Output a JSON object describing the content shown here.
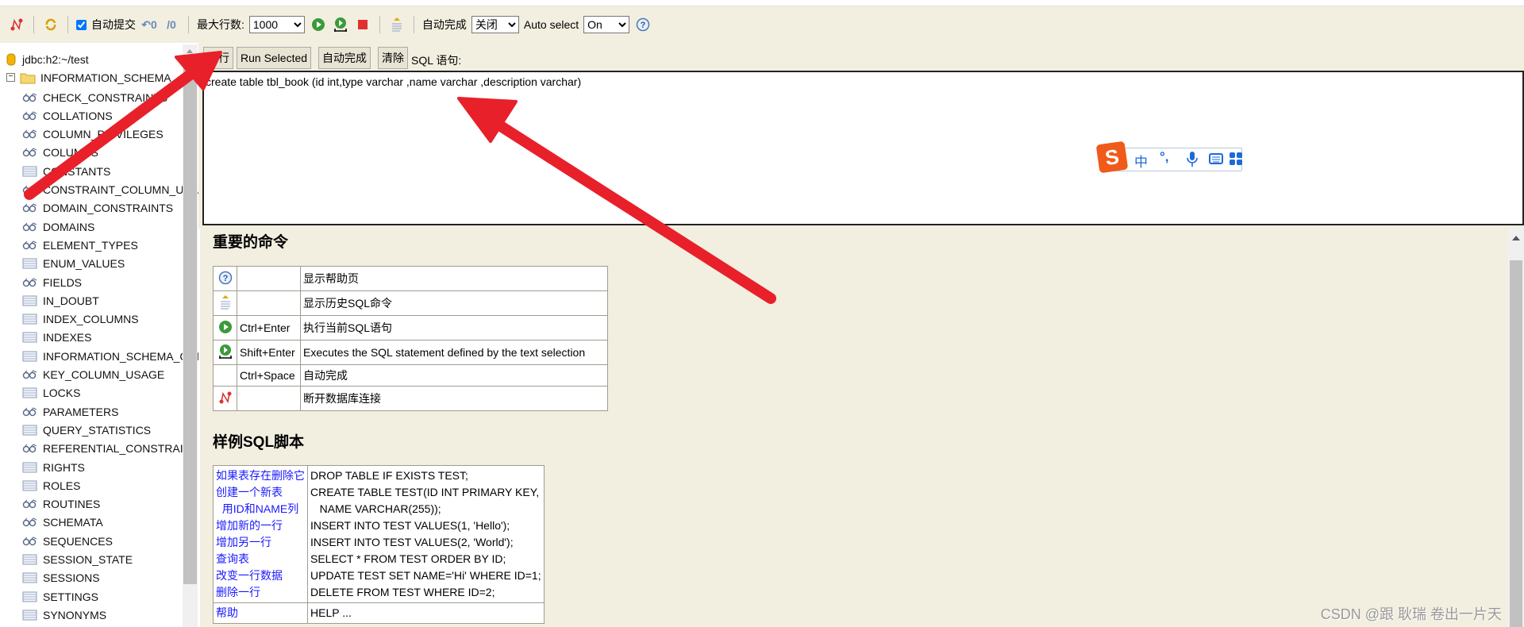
{
  "toolbar": {
    "autocommit_label": "自动提交",
    "autocommit_checked": true,
    "max_rows_label": "最大行数:",
    "max_rows_value": "1000",
    "autocomplete_label": "自动完成",
    "autocomplete_value": "关闭",
    "auto_select_label": "Auto select",
    "auto_select_value": "On"
  },
  "tree": {
    "connection": "jdbc:h2:~/test",
    "schema": "INFORMATION_SCHEMA",
    "items": [
      {
        "label": "CHECK_CONSTRAINTS",
        "icon": "view"
      },
      {
        "label": "COLLATIONS",
        "icon": "view"
      },
      {
        "label": "COLUMN_PRIVILEGES",
        "icon": "view"
      },
      {
        "label": "COLUMNS",
        "icon": "view"
      },
      {
        "label": "CONSTANTS",
        "icon": "table"
      },
      {
        "label": "CONSTRAINT_COLUMN_USAGE",
        "icon": "view"
      },
      {
        "label": "DOMAIN_CONSTRAINTS",
        "icon": "view"
      },
      {
        "label": "DOMAINS",
        "icon": "view"
      },
      {
        "label": "ELEMENT_TYPES",
        "icon": "view"
      },
      {
        "label": "ENUM_VALUES",
        "icon": "table"
      },
      {
        "label": "FIELDS",
        "icon": "view"
      },
      {
        "label": "IN_DOUBT",
        "icon": "table"
      },
      {
        "label": "INDEX_COLUMNS",
        "icon": "table"
      },
      {
        "label": "INDEXES",
        "icon": "table"
      },
      {
        "label": "INFORMATION_SCHEMA_CATALOG_NAME",
        "icon": "table"
      },
      {
        "label": "KEY_COLUMN_USAGE",
        "icon": "view"
      },
      {
        "label": "LOCKS",
        "icon": "table"
      },
      {
        "label": "PARAMETERS",
        "icon": "view"
      },
      {
        "label": "QUERY_STATISTICS",
        "icon": "table"
      },
      {
        "label": "REFERENTIAL_CONSTRAINTS",
        "icon": "view"
      },
      {
        "label": "RIGHTS",
        "icon": "table"
      },
      {
        "label": "ROLES",
        "icon": "table"
      },
      {
        "label": "ROUTINES",
        "icon": "view"
      },
      {
        "label": "SCHEMATA",
        "icon": "view"
      },
      {
        "label": "SEQUENCES",
        "icon": "view"
      },
      {
        "label": "SESSION_STATE",
        "icon": "table"
      },
      {
        "label": "SESSIONS",
        "icon": "table"
      },
      {
        "label": "SETTINGS",
        "icon": "table"
      },
      {
        "label": "SYNONYMS",
        "icon": "table"
      }
    ]
  },
  "editor": {
    "buttons": [
      "执行",
      "Run Selected",
      "自动完成",
      "清除"
    ],
    "sql_label": "SQL 语句:",
    "sql_text": "create table tbl_book (id int,type varchar ,name varchar ,description varchar)"
  },
  "ime": {
    "mode": "中",
    "punct": "°,"
  },
  "help": {
    "commands_title": "重要的命令",
    "commands": [
      {
        "icon": "help",
        "key": "",
        "desc": "显示帮助页"
      },
      {
        "icon": "history",
        "key": "",
        "desc": "显示历史SQL命令"
      },
      {
        "icon": "run",
        "key": "Ctrl+Enter",
        "desc": "执行当前SQL语句"
      },
      {
        "icon": "run-selected",
        "key": "Shift+Enter",
        "desc": "Executes the SQL statement defined by the text selection"
      },
      {
        "icon": "",
        "key": "Ctrl+Space",
        "desc": "自动完成"
      },
      {
        "icon": "disconnect",
        "key": "",
        "desc": "断开数据库连接"
      }
    ],
    "samples_title": "样例SQL脚本",
    "samples": {
      "links": [
        "如果表存在删除它",
        "创建一个新表",
        "  用ID和NAME列",
        "增加新的一行",
        "增加另一行",
        "查询表",
        "改变一行数据",
        "删除一行"
      ],
      "code": [
        "DROP TABLE IF EXISTS TEST;",
        "CREATE TABLE TEST(ID INT PRIMARY KEY,",
        "   NAME VARCHAR(255));",
        "INSERT INTO TEST VALUES(1, 'Hello');",
        "INSERT INTO TEST VALUES(2, 'World');",
        "SELECT * FROM TEST ORDER BY ID;",
        "UPDATE TEST SET NAME='Hi' WHERE ID=1;",
        "DELETE FROM TEST WHERE ID=2;"
      ],
      "help_link": "帮助",
      "help_code": "HELP ..."
    }
  },
  "watermark": "CSDN @跟 耿瑞 卷出一片天",
  "colors": {
    "panel_bg": "#f2efe0",
    "link": "#1a1aff",
    "annotation_arrow": "#e8202a"
  }
}
